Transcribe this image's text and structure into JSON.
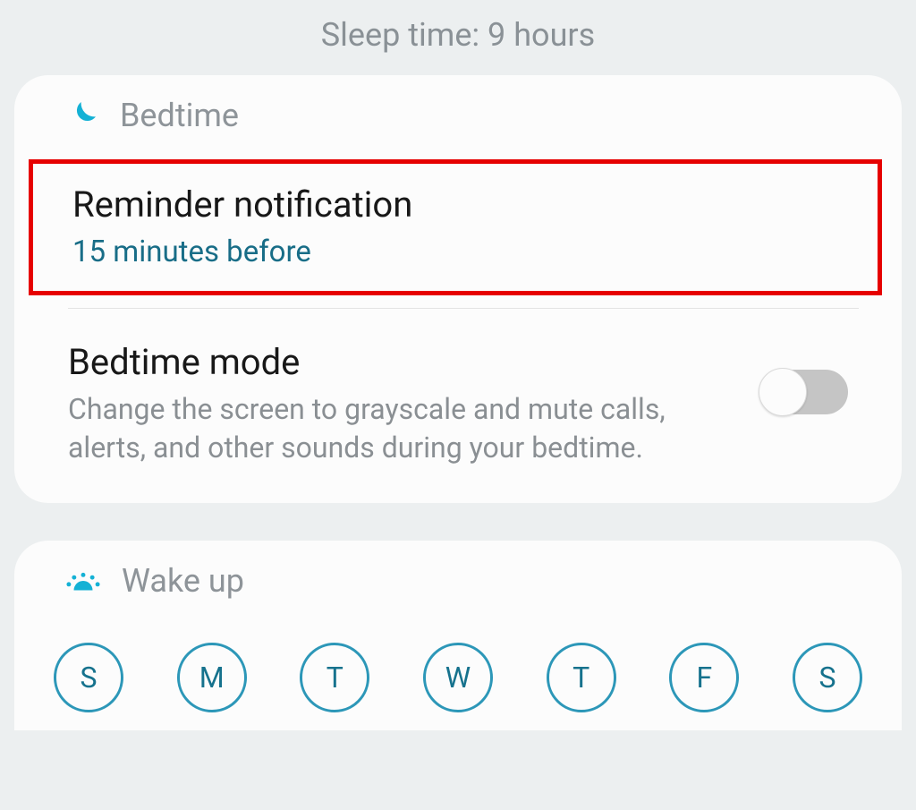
{
  "header": {
    "sleepTimeLabel": "Sleep time: 9 hours"
  },
  "bedtimeCard": {
    "title": "Bedtime",
    "reminder": {
      "title": "Reminder notification",
      "value": "15 minutes before"
    },
    "mode": {
      "title": "Bedtime mode",
      "description": "Change the screen to grayscale and mute calls, alerts, and other sounds during your bedtime.",
      "enabled": false
    }
  },
  "wakeupCard": {
    "title": "Wake up",
    "days": [
      {
        "label": "S"
      },
      {
        "label": "M"
      },
      {
        "label": "T"
      },
      {
        "label": "W"
      },
      {
        "label": "T"
      },
      {
        "label": "F"
      },
      {
        "label": "S"
      }
    ]
  },
  "colors": {
    "accent": "#14b1d5",
    "accentDark": "#186d87",
    "highlight": "#e60000"
  }
}
